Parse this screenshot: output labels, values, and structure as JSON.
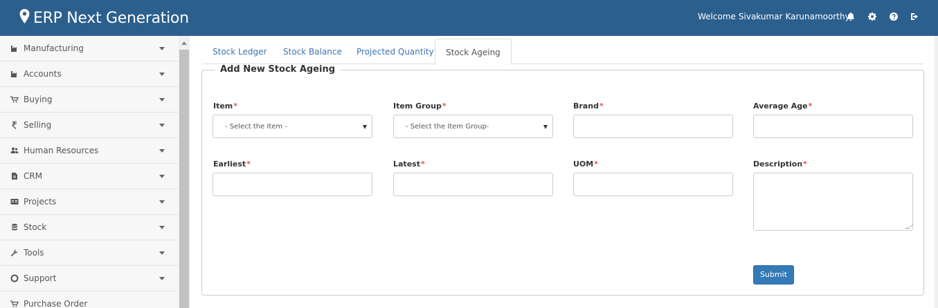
{
  "header": {
    "app_title": "ERP Next Generation",
    "welcome_prefix": "Welcome",
    "user_first": "Sivakumar",
    "user_last": "Karunamoorthy.",
    "bg_color": "#2b5f8e",
    "icons": [
      "map-marker-icon",
      "bell-icon",
      "gear-icon",
      "help-icon",
      "sign-out-icon"
    ]
  },
  "sidebar": {
    "items": [
      {
        "label": "Manufacturing",
        "icon": "factory-icon"
      },
      {
        "label": "Accounts",
        "icon": "factory-icon"
      },
      {
        "label": "Buying",
        "icon": "cart-icon"
      },
      {
        "label": "Selling",
        "icon": "rupee-icon"
      },
      {
        "label": "Human Resources",
        "icon": "users-icon"
      },
      {
        "label": "CRM",
        "icon": "file-icon"
      },
      {
        "label": "Projects",
        "icon": "projects-icon"
      },
      {
        "label": "Stock",
        "icon": "database-icon"
      },
      {
        "label": "Tools",
        "icon": "wrench-icon"
      },
      {
        "label": "Support",
        "icon": "lifebuoy-icon"
      },
      {
        "label": "Purchase Order",
        "icon": "cart-icon"
      }
    ]
  },
  "tabs": [
    {
      "label": "Stock Ledger",
      "active": false
    },
    {
      "label": "Stock Balance",
      "active": false
    },
    {
      "label": "Projected Quantity",
      "active": false
    },
    {
      "label": "Stock Ageing",
      "active": true
    }
  ],
  "form": {
    "legend": "Add New Stock Ageing",
    "required_mark": "*",
    "fields": {
      "item": {
        "label": "Item",
        "value": "- Select the Item -"
      },
      "item_group": {
        "label": "Item Group",
        "value": "- Select the Item Group-"
      },
      "brand": {
        "label": "Brand",
        "value": ""
      },
      "average_age": {
        "label": "Average Age",
        "value": ""
      },
      "earliest": {
        "label": "Earliest",
        "value": ""
      },
      "latest": {
        "label": "Latest",
        "value": ""
      },
      "uom": {
        "label": "UOM",
        "value": ""
      },
      "description": {
        "label": "Description",
        "value": ""
      }
    },
    "submit_label": "Submit",
    "submit_color": "#337ab7"
  }
}
